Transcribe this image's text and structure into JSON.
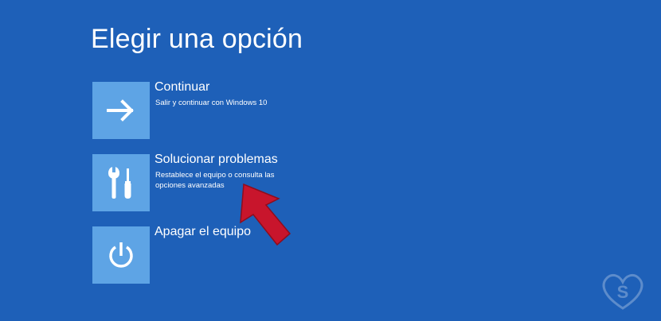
{
  "screen": {
    "title": "Elegir una opción",
    "background_color": "#1e60b8",
    "tile_color": "#5ea4e5"
  },
  "options": [
    {
      "icon": "arrow-right-icon",
      "label": "Continuar",
      "description": "Salir y continuar con Windows 10"
    },
    {
      "icon": "tools-icon",
      "label": "Solucionar problemas",
      "description": "Restablece el equipo o consulta las opciones avanzadas"
    },
    {
      "icon": "power-icon",
      "label": "Apagar el equipo",
      "description": ""
    }
  ],
  "annotation": {
    "arrow_color": "#c8152c"
  }
}
